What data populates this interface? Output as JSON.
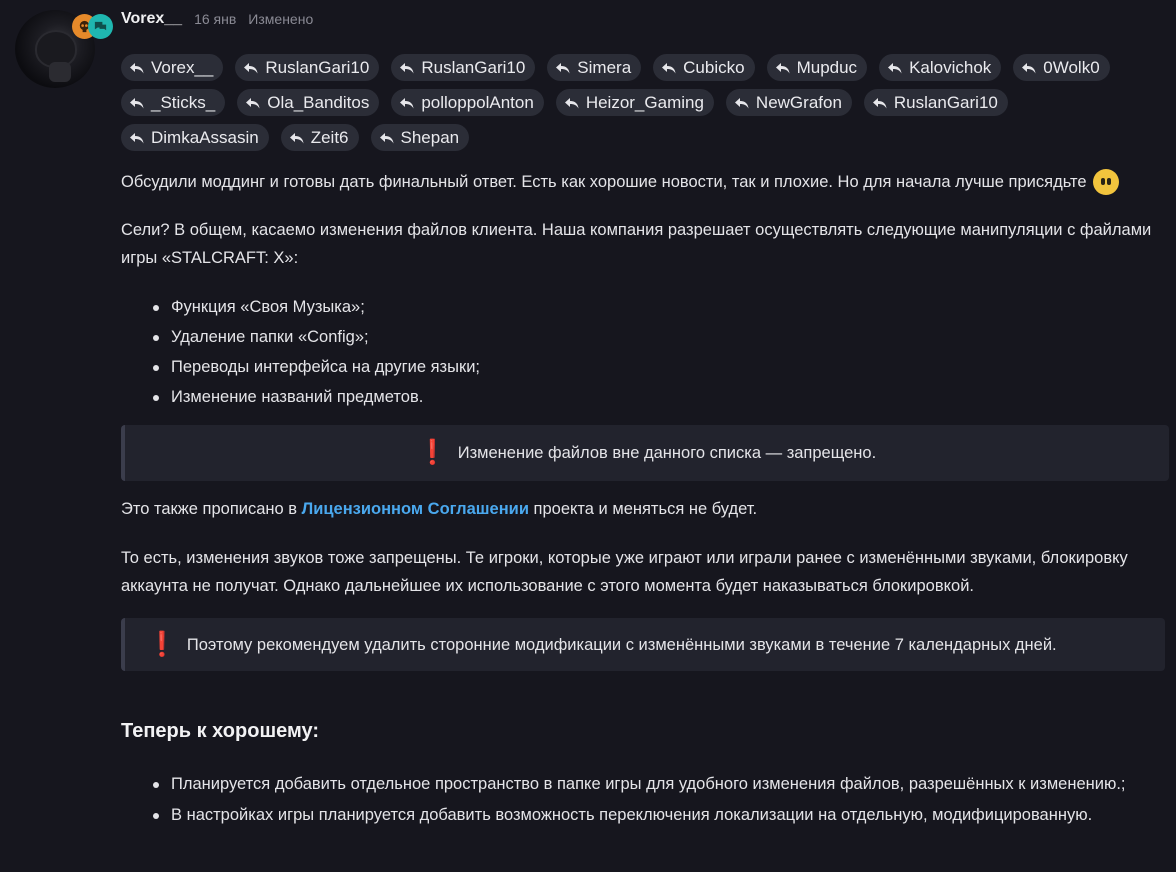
{
  "post": {
    "username": "Vorex__",
    "date": "16 янв",
    "edited": "Изменено"
  },
  "mentions": [
    "Vorex__",
    "RuslanGari10",
    "RuslanGari10",
    "Simera",
    "Cubicko",
    "Mupduc",
    "Kalovichok",
    "0Wolk0",
    "_Sticks_",
    "Ola_Banditos",
    "polloppolAnton",
    "Heizor_Gaming",
    "NewGrafon",
    "RuslanGari10",
    "DimkaAssasin",
    "Zeit6",
    "Shepan"
  ],
  "content": {
    "p1": "Обсудили моддинг и готовы дать финальный ответ. Есть как хорошие новости, так и плохие. Но для начала лучше присядьте",
    "p2": "Сели? В общем, касаемо изменения файлов клиента. Наша компания разрешает осуществлять следующие манипуляции с файлами игры «STALCRAFT: X»:",
    "list1": [
      "Функция «Своя Музыка»;",
      "Удаление папки «Config»;",
      "Переводы интерфейса на другие языки;",
      "Изменение названий предметов."
    ],
    "callout1": "Изменение файлов вне данного списка — запрещено.",
    "p3_before": "Это также прописано в ",
    "p3_link": "Лицензионном Соглашении",
    "p3_after": " проекта и меняться не будет.",
    "p4": "То есть, изменения звуков тоже запрещены. Те игроки, которые уже играют или играли ранее с изменёнными звуками, блокировку аккаунта не получат. Однако дальнейшее их использование с этого момента будет наказываться блокировкой.",
    "callout2": "Поэтому рекомендуем удалить сторонние модификации с изменёнными звуками в течение 7 календарных дней.",
    "heading": "Теперь к хорошему:",
    "list2": [
      "Планируется добавить отдельное пространство в папке игры для удобного изменения файлов, разрешённых к изменению.;",
      "В настройках игры планируется добавить возможность переключения локализации на отдельную, модифицированную."
    ]
  },
  "icons": {
    "mention": "reply-arrow-icon",
    "badge1": "skull-badge-icon",
    "badge2": "chat-badge-icon",
    "emoji": "neutral-face-emoji-icon",
    "exclamation": "exclamation-icon"
  },
  "colors": {
    "background": "#16161e",
    "link": "#4aa8ee",
    "exclamation": "#e0293d",
    "badge_orange": "#e68a2a",
    "badge_teal": "#1fb7b0"
  }
}
